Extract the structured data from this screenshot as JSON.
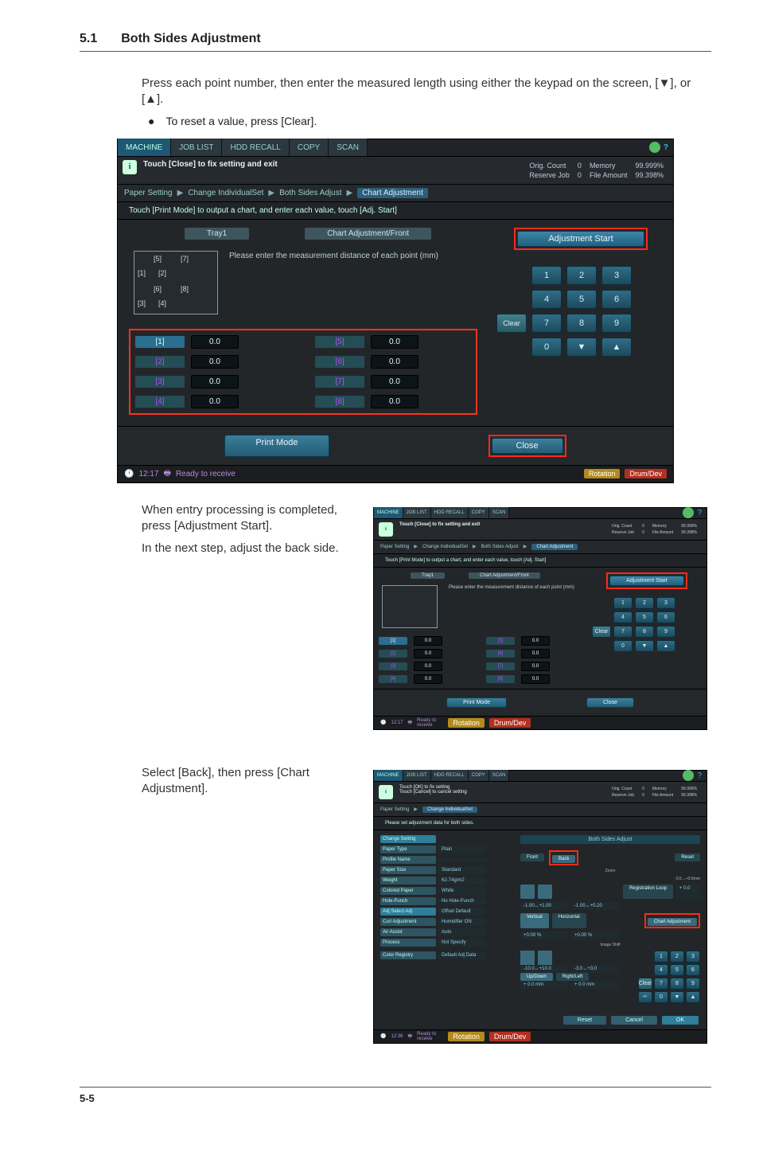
{
  "section": {
    "num": "5.1",
    "title": "Both Sides Adjustment"
  },
  "para1": "Press each point number, then enter the measured length using either the keypad on the screen, [▼], or [▲].",
  "bullets": [
    "To reset a value, press [Clear]."
  ],
  "para2": "When entry processing is completed, press [Adjustment Start].",
  "para3": "In the next step, adjust the back side.",
  "para4": "Select [Back], then press [Chart Adjustment].",
  "footer": "5-5",
  "ui": {
    "topTabs": {
      "machine": "MACHINE",
      "jobList": "JOB LIST",
      "hddRecall": "HDD RECALL",
      "copy": "COPY",
      "scan": "SCAN"
    },
    "infoBar": {
      "text": "Touch [Close] to fix setting and exit",
      "stats": {
        "origCountLabel": "Orig. Count",
        "origCount": "0",
        "reserveLabel": "Reserve Job",
        "reserve": "0",
        "memoryLabel": "Memory",
        "memory": "99.999%",
        "fileAmountLabel": "File Amount",
        "fileAmount": "99.398%"
      }
    },
    "crumb": {
      "seg1": "Paper Setting",
      "seg2": "Change IndividualSet",
      "seg3": "Both Sides Adjust",
      "seg4": "Chart Adjustment"
    },
    "subText": "Touch [Print Mode] to output a chart, and enter each value, touch [Adj. Start]",
    "chipTray": "Tray1",
    "chipMode": "Chart Adjustment/Front",
    "diagramMsg": "Please enter the measurement distance of each point (mm)",
    "diagNums": [
      "[1]",
      "[2]",
      "[3]",
      "[4]",
      "[5]",
      "[6]",
      "[7]",
      "[8]"
    ],
    "adjStart": "Adjustment Start",
    "values": [
      {
        "label": "[1]",
        "val": "0.0"
      },
      {
        "label": "[5]",
        "val": "0.0"
      },
      {
        "label": "[2]",
        "val": "0.0"
      },
      {
        "label": "[6]",
        "val": "0.0"
      },
      {
        "label": "[3]",
        "val": "0.0"
      },
      {
        "label": "[7]",
        "val": "0.0"
      },
      {
        "label": "[4]",
        "val": "0.0"
      },
      {
        "label": "[8]",
        "val": "0.0"
      }
    ],
    "keypad": [
      "1",
      "2",
      "3",
      "4",
      "5",
      "6",
      "7",
      "8",
      "9",
      "0",
      "▼",
      "▲"
    ],
    "clear": "Clear",
    "printMode": "Print Mode",
    "close": "Close",
    "statusTime": "12:17",
    "statusText": "Ready to receive",
    "statusPills": {
      "rotation": "Rotation",
      "drum": "Drum/Dev"
    }
  },
  "ui3": {
    "infoLine1": "Touch [OK] to fix setting",
    "infoLine2": "Touch [Cancel] to cancel setting",
    "crumbSeg2": "Change IndividualSet",
    "sub": "Please set adjustment data for both sides.",
    "changeSetting": "Change Setting",
    "headTitle": "Both Sides Adjust",
    "labels": {
      "paperType": "Paper Type",
      "paperTypeV": "Plain",
      "profile": "Profile Name",
      "profileV": "",
      "size": "Paper Size",
      "sizeV": "Standard",
      "weight": "Weight",
      "weightV": "62-74g/m2",
      "colored": "Colored Paper",
      "coloredV": "White",
      "punch": "Hole-Punch",
      "punchV": "No Hole-Punch",
      "adjSelect": "Adj Select Adj",
      "adjSelectV": "Offset Default",
      "curl": "Curl Adjustment",
      "curlV": "Humidifier ON",
      "air": "Air Assist",
      "airV": "Auto",
      "process": "Process",
      "processV": "Not Specify",
      "colorReg": "Color Registry",
      "colorRegV": "Default Adj Data"
    },
    "front": "Front",
    "back": "Back",
    "reset": "Reset",
    "zoom": "Zoom",
    "registration": "Registration Loop",
    "regVal": "+ 0.0",
    "zoomRange": "-0.5↔+0.5mm",
    "v1": "-1.00↔+1.00",
    "v2": "-1.00↔+0.20",
    "vertical": "Vertical",
    "horizontal": "Horizontal",
    "vv": "+0.00 %",
    "hv": "+0.00 %",
    "chartAdj": "Chart Adjustment",
    "imageShift": "Image Shift",
    "sv1": "-10.0↔+10.0",
    "sv2": "-3.0↔+3.0",
    "updown": "Up/Down",
    "rightleft": "Right/Left",
    "udv": "+ 0.0 mm",
    "rlv": "+ 0.0 mm",
    "kp": [
      "1",
      "2",
      "3",
      "4",
      "5",
      "6",
      "7",
      "8",
      "9",
      "0",
      "▼",
      "▲"
    ],
    "resetBtn": "Reset",
    "cancel": "Cancel",
    "ok": "OK",
    "statusTime": "12:36"
  }
}
